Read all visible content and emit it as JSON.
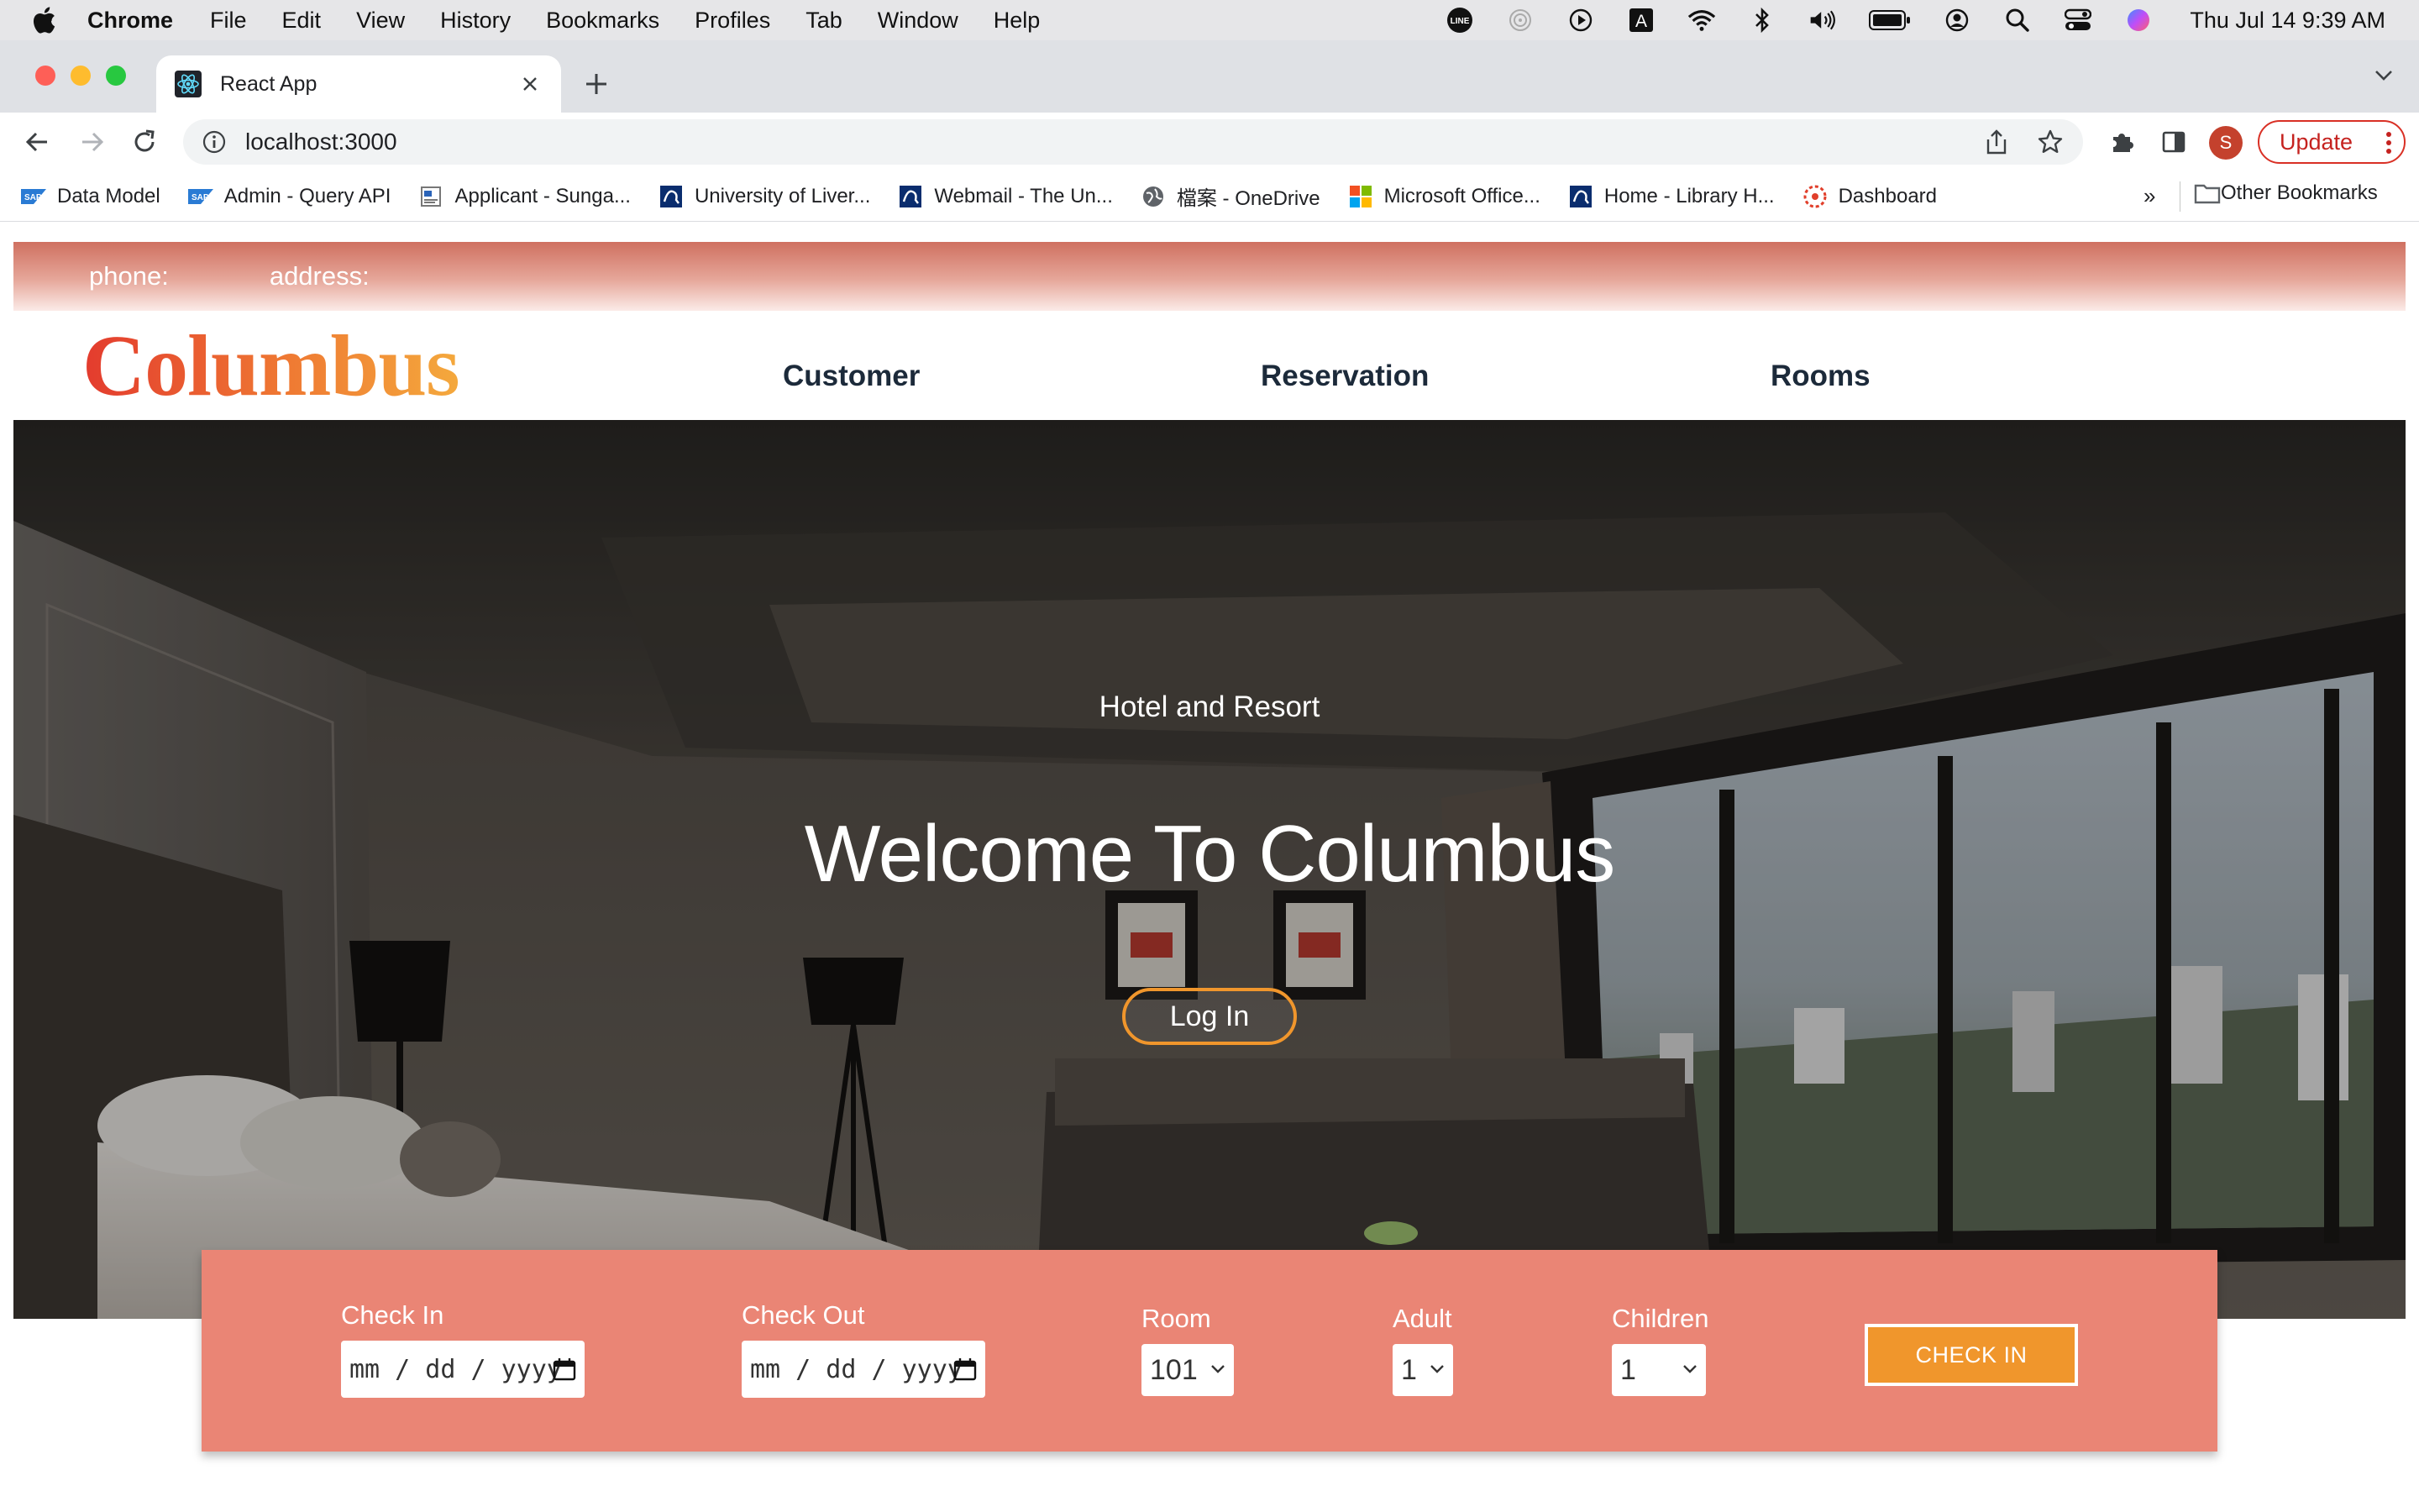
{
  "os_menubar": {
    "app_name": "Chrome",
    "menus": [
      "File",
      "Edit",
      "View",
      "History",
      "Bookmarks",
      "Profiles",
      "Tab",
      "Window",
      "Help"
    ],
    "clock": "Thu Jul 14  9:39 AM",
    "status_icons": [
      "line-icon",
      "fingerprint-icon",
      "play-icon",
      "keyboard-a-icon",
      "wifi-icon",
      "bluetooth-icon",
      "volume-icon",
      "battery-icon",
      "user-circle-icon",
      "spotlight-search-icon",
      "control-center-icon",
      "siri-icon"
    ]
  },
  "browser": {
    "tab": {
      "title": "React App",
      "favicon": "react-icon"
    },
    "url": "localhost:3000",
    "update_label": "Update",
    "profile_initial": "S",
    "bookmarks": [
      {
        "label": "Data Model",
        "icon": "sap-icon"
      },
      {
        "label": "Admin - Query API",
        "icon": "sap-icon"
      },
      {
        "label": "Applicant - Sunga...",
        "icon": "page-icon"
      },
      {
        "label": "University of Liver...",
        "icon": "liverpool-icon"
      },
      {
        "label": "Webmail - The Un...",
        "icon": "liverpool-icon"
      },
      {
        "label": "檔案 - OneDrive",
        "icon": "globe-icon"
      },
      {
        "label": "Microsoft Office...",
        "icon": "microsoft-icon"
      },
      {
        "label": "Home - Library H...",
        "icon": "liverpool-icon"
      },
      {
        "label": "Dashboard",
        "icon": "canvas-icon"
      }
    ],
    "bookmarks_overflow": "»",
    "other_bookmarks": "Other Bookmarks"
  },
  "site": {
    "topbar": {
      "phone_label": "phone:",
      "address_label": "address:"
    },
    "logo": "Columbus",
    "nav": [
      "Customer",
      "Reservation",
      "Rooms"
    ],
    "hero": {
      "subtitle": "Hotel and Resort",
      "title": "Welcome To Columbus",
      "login_label": "Log In"
    },
    "booking": {
      "check_in_label": "Check In",
      "check_in_placeholder": "mm / dd / yyyy",
      "check_out_label": "Check Out",
      "check_out_placeholder": "mm / dd / yyyy",
      "room_label": "Room",
      "room_value": "101",
      "adult_label": "Adult",
      "adult_value": "1",
      "children_label": "Children",
      "children_value": "1",
      "submit_label": "CHECK IN"
    }
  },
  "colors": {
    "accent_orange": "#f0962c",
    "booking_bg": "#ea8575",
    "topbar_start": "#cf7060",
    "nav_text": "#1c2a3a"
  }
}
